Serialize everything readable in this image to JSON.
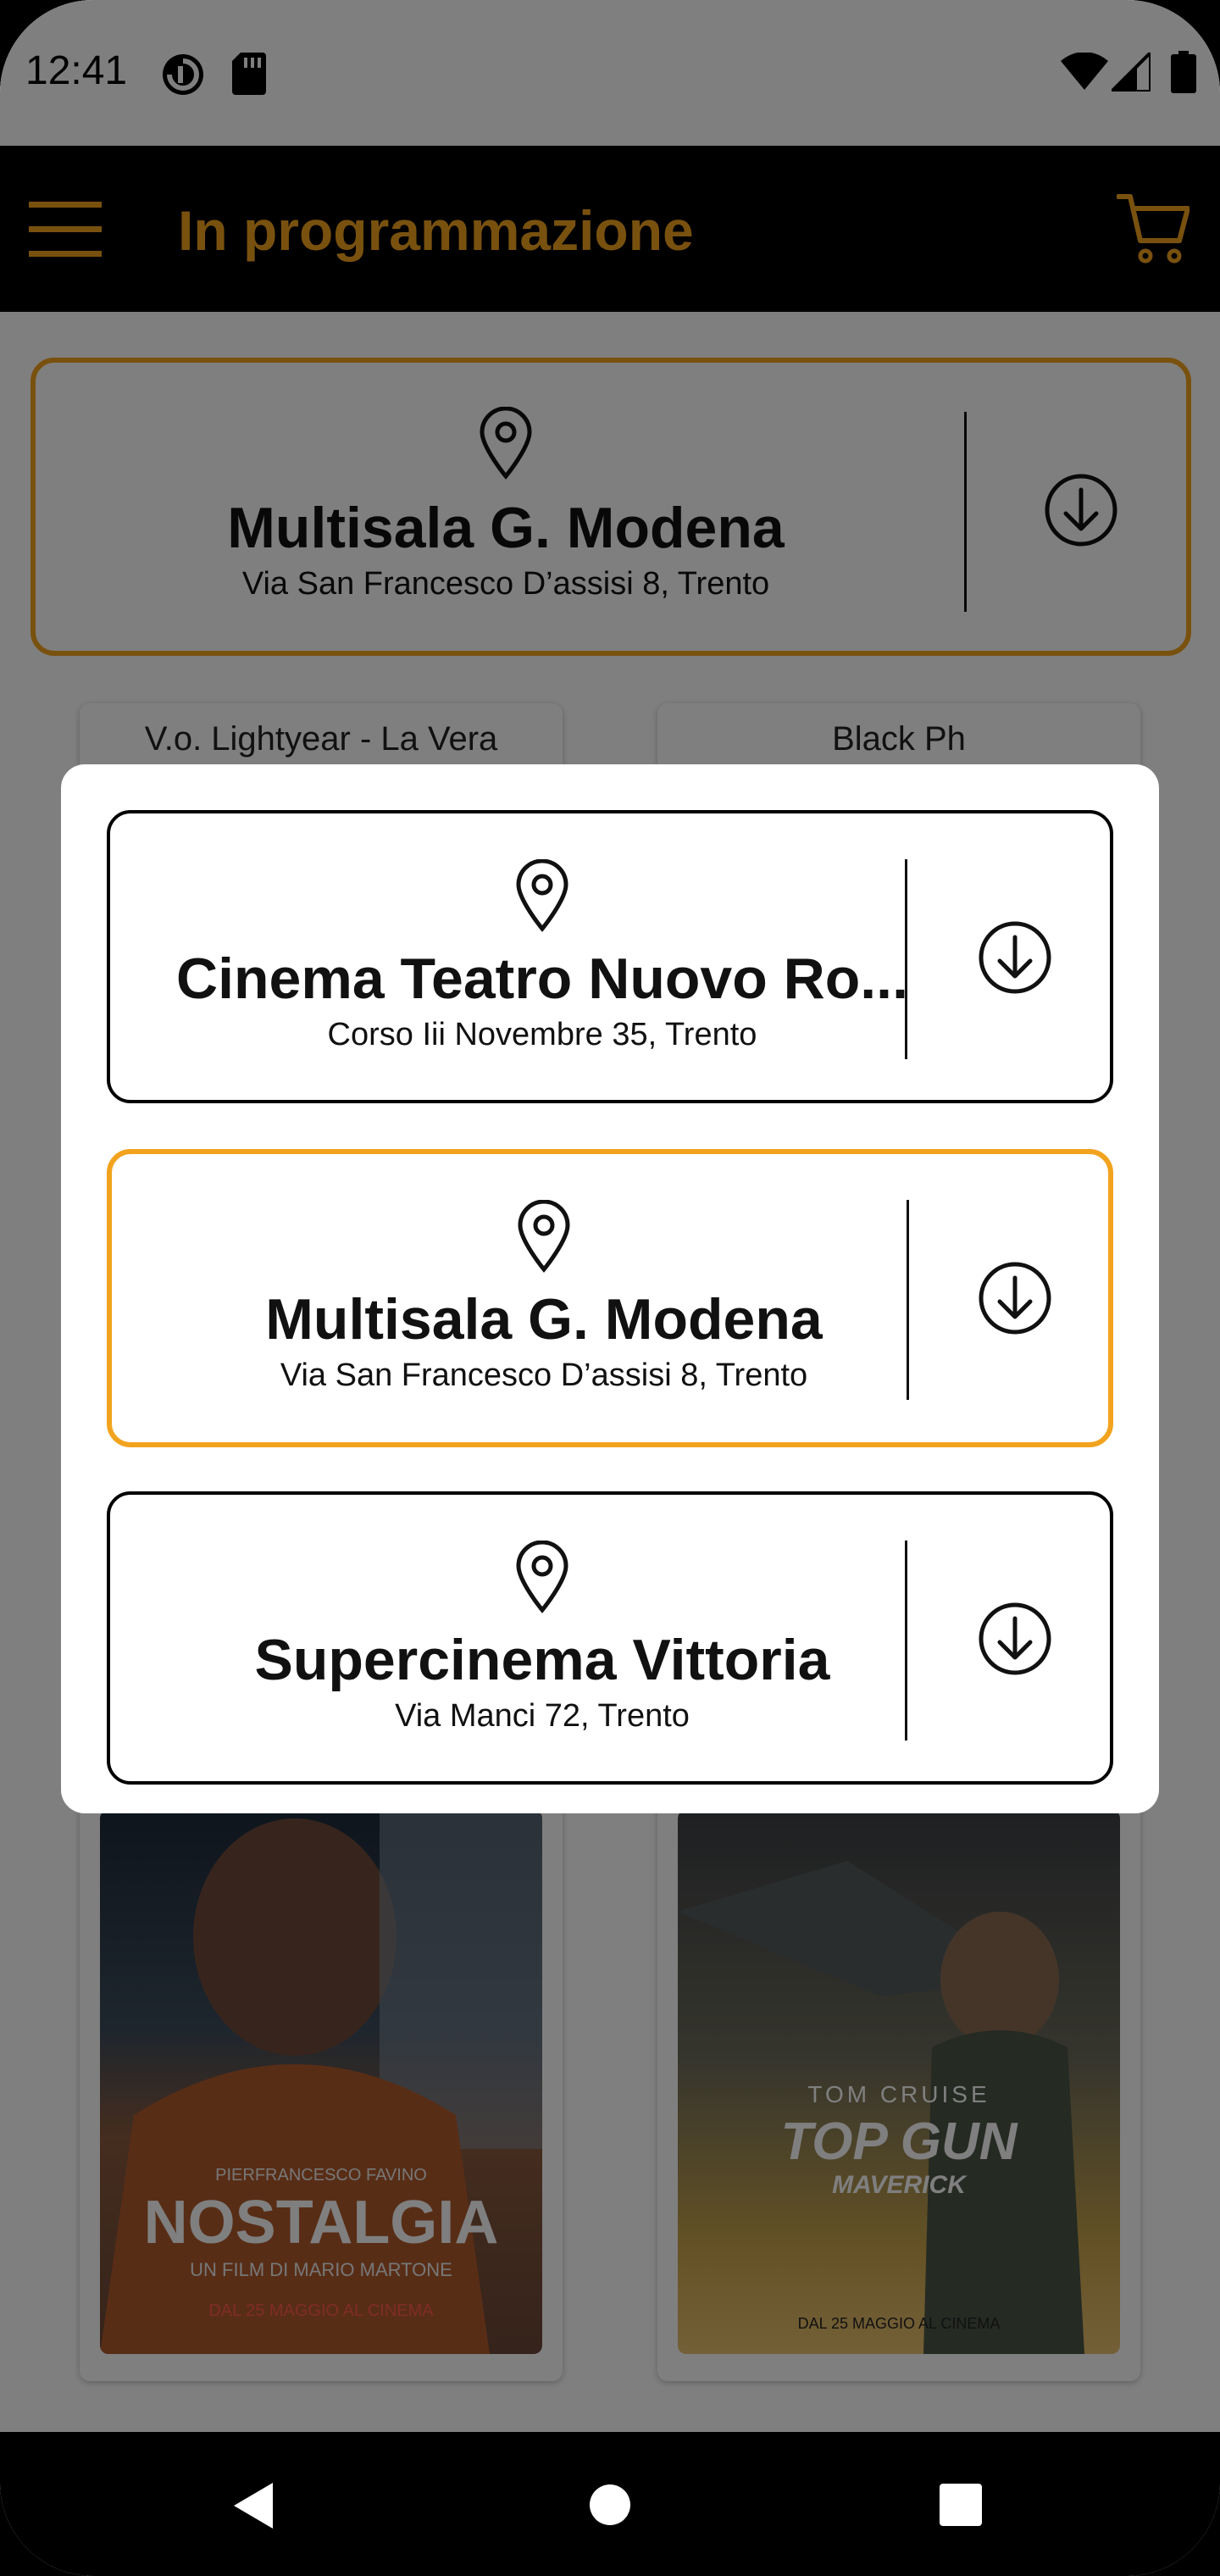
{
  "status_bar": {
    "time": "12:41",
    "left_icons": [
      "data-saver-icon",
      "sd-card-icon"
    ],
    "right_icons": [
      "wifi-icon",
      "signal-icon",
      "battery-icon"
    ]
  },
  "app_bar": {
    "title": "In programmazione",
    "menu_icon": "hamburger-menu-icon",
    "cart_icon": "cart-icon"
  },
  "selected_cinema": {
    "name": "Multisala G. Modena",
    "address": "Via San Francesco D’assisi 8, Trento"
  },
  "movies": [
    {
      "title": "V.o. Lightyear - La Vera",
      "poster_text": [
        "PIERFRANCESCO FAVINO",
        "NOSTALGIA",
        "UN FILM DI MARIO MARTONE",
        "DAL 25 MAGGIO AL CINEMA"
      ]
    },
    {
      "title": "Black Ph",
      "poster_text": [
        "TOM CRUISE",
        "TOP GUN",
        "MAVERICK",
        "DAL 25 MAGGIO AL CINEMA"
      ]
    }
  ],
  "dialog": {
    "cinemas": [
      {
        "name": "Cinema Teatro Nuovo Ro...",
        "address": "Corso Iii Novembre 35, Trento",
        "selected": false
      },
      {
        "name": "Multisala G. Modena",
        "address": "Via San Francesco D’assisi 8, Trento",
        "selected": true
      },
      {
        "name": "Supercinema Vittoria",
        "address": "Via Manci 72, Trento",
        "selected": false
      }
    ]
  },
  "colors": {
    "accent": "#f2a31e",
    "app_bar": "#000000",
    "scrim": "rgba(0,0,0,0.5)"
  },
  "nav_bar": {
    "buttons": [
      "back-icon",
      "home-icon",
      "recents-icon"
    ]
  }
}
